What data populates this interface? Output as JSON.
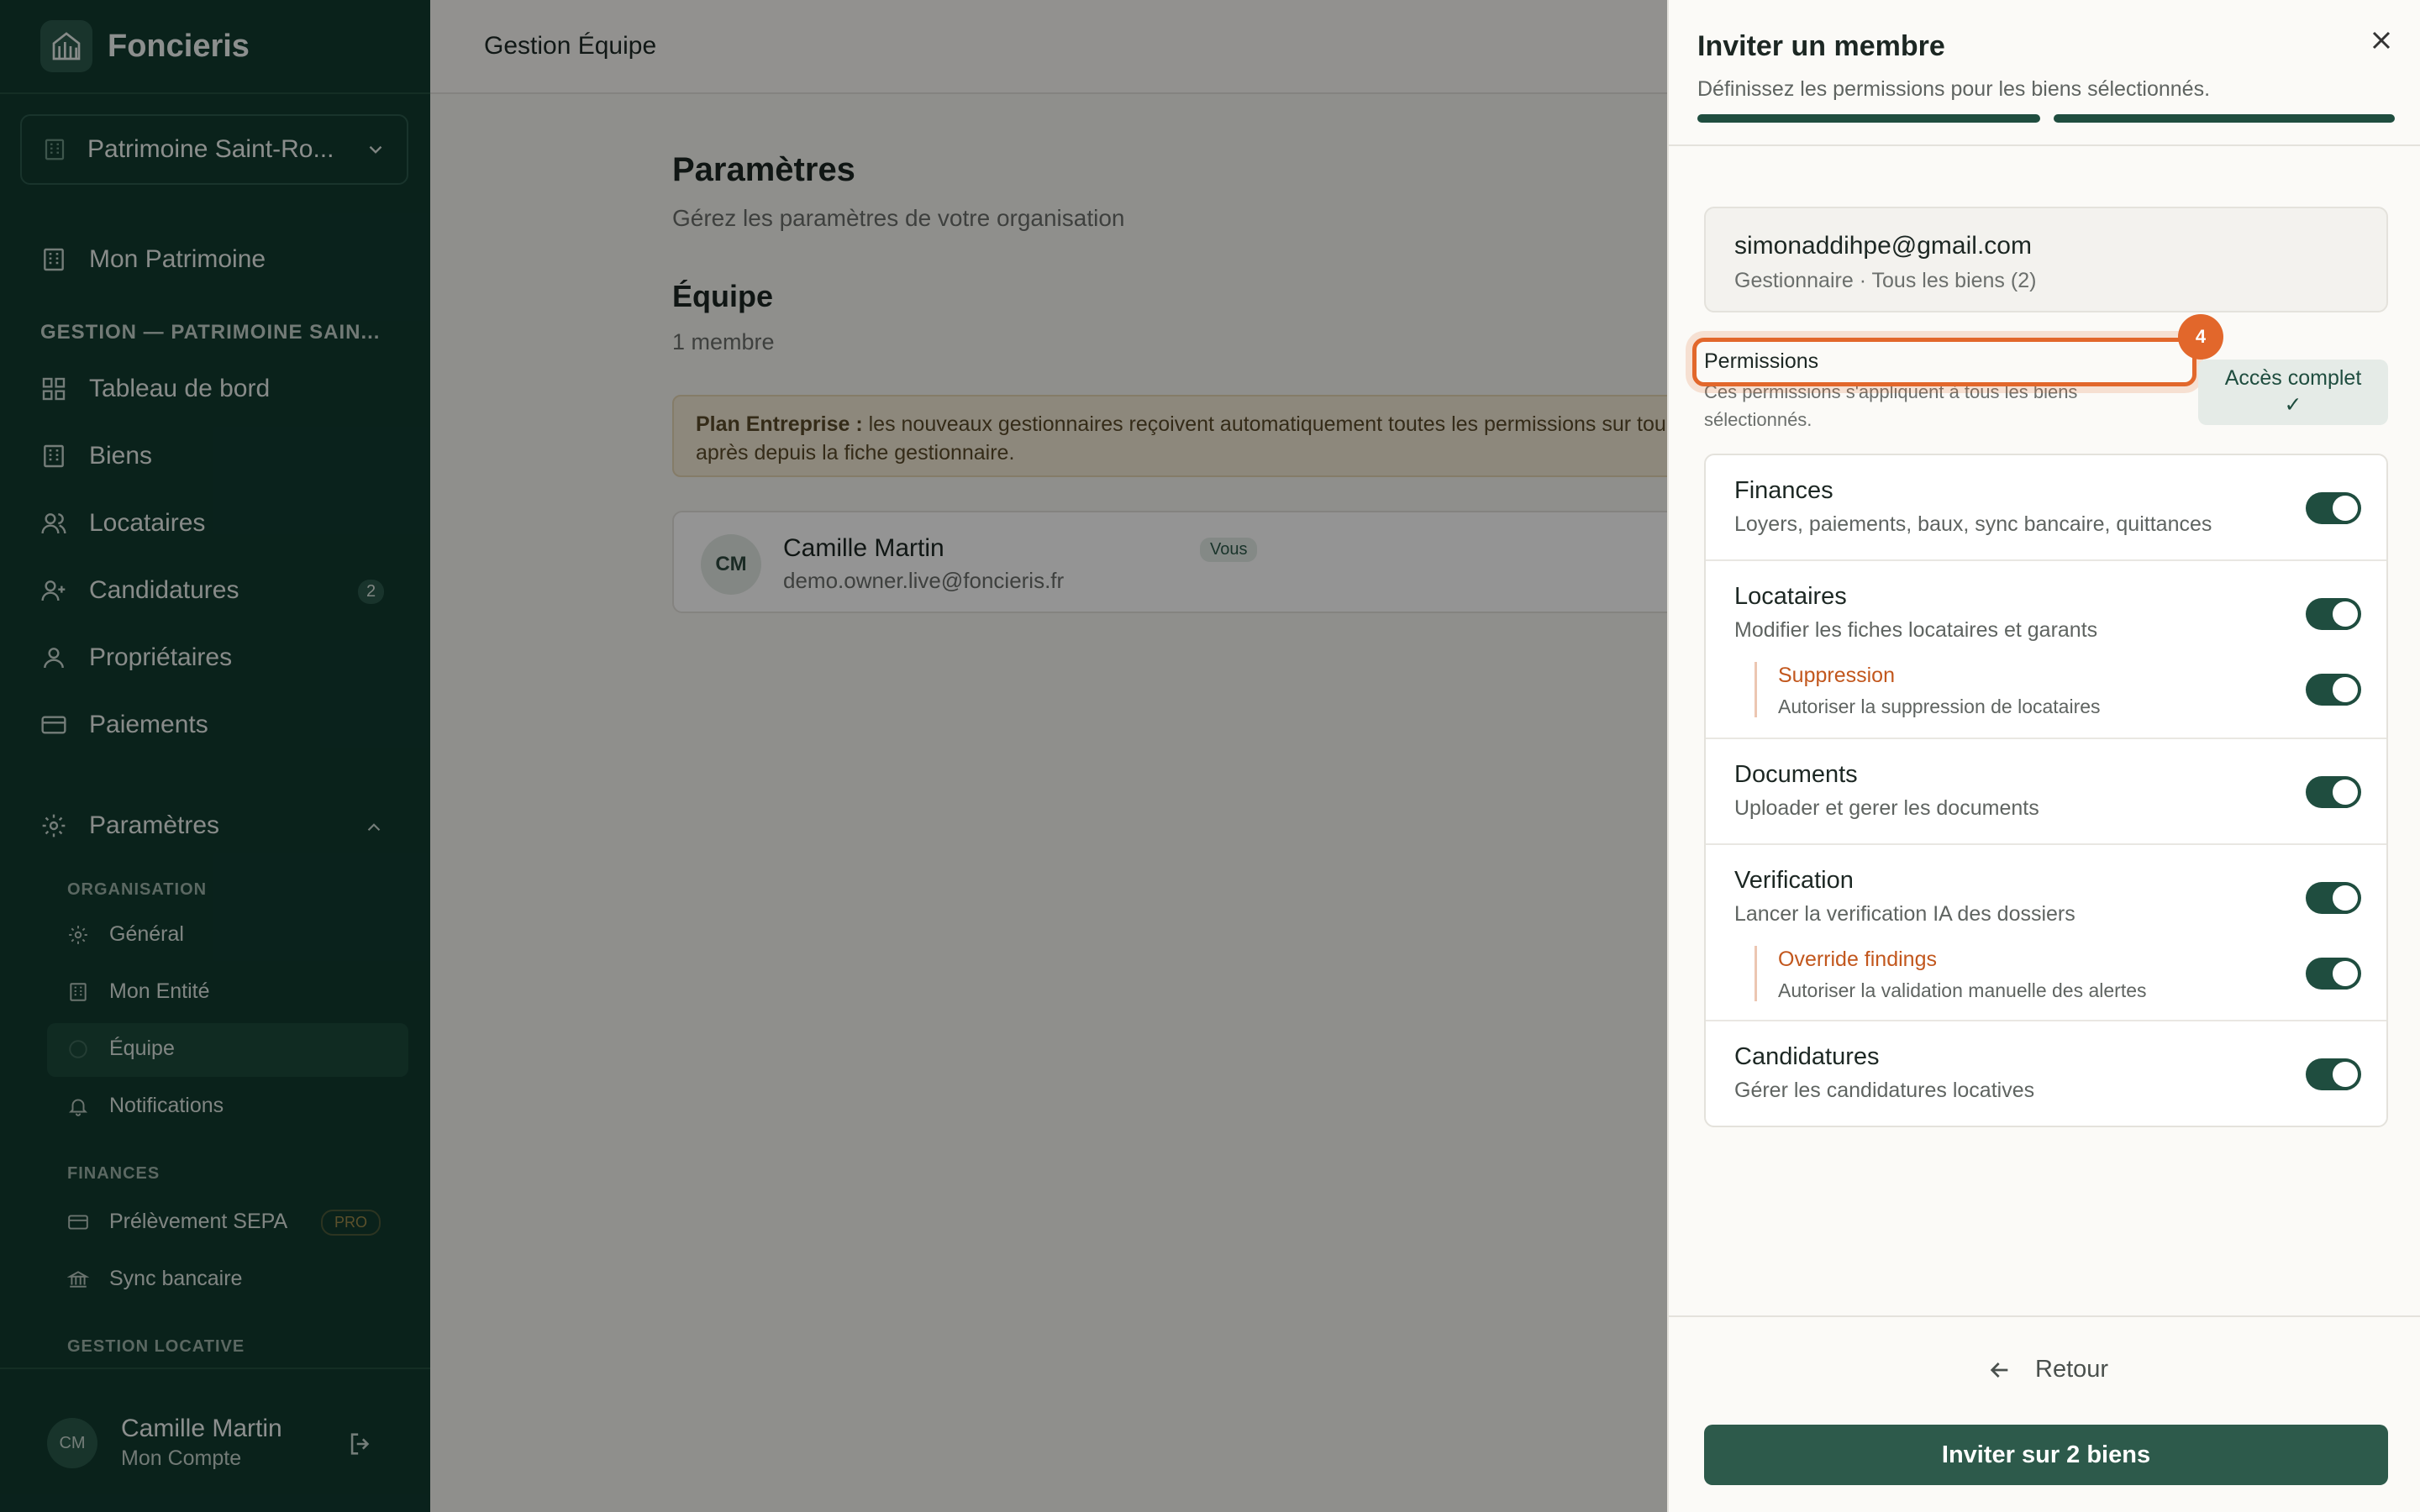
{
  "app": {
    "name": "Foncieris"
  },
  "sidebar": {
    "org_select": "Patrimoine Saint-Ro...",
    "top_items": [
      {
        "label": "Mon Patrimoine",
        "icon": "building-icon"
      }
    ],
    "section_gestion": "GESTION — PATRIMOINE SAIN...",
    "items": [
      {
        "label": "Tableau de bord",
        "icon": "dashboard-icon"
      },
      {
        "label": "Biens",
        "icon": "building-icon"
      },
      {
        "label": "Locataires",
        "icon": "users-icon"
      },
      {
        "label": "Candidatures",
        "icon": "user-plus-icon",
        "badge": "2"
      },
      {
        "label": "Propriétaires",
        "icon": "user-icon"
      },
      {
        "label": "Paiements",
        "icon": "card-icon"
      }
    ],
    "settings": {
      "label": "Paramètres",
      "icon": "gear-icon"
    },
    "sub_org_title": "ORGANISATION",
    "sub_org": [
      {
        "label": "Général",
        "icon": "gear-icon"
      },
      {
        "label": "Mon Entité",
        "icon": "building-icon"
      },
      {
        "label": "Équipe",
        "icon": "team-icon"
      },
      {
        "label": "Notifications",
        "icon": "bell-icon"
      }
    ],
    "sub_fin_title": "FINANCES",
    "sub_fin": [
      {
        "label": "Prélèvement SEPA",
        "icon": "card-icon",
        "badge": "PRO"
      },
      {
        "label": "Sync bancaire",
        "icon": "bank-icon"
      }
    ],
    "sub_loc_title": "GESTION LOCATIVE",
    "user": {
      "initials": "CM",
      "name": "Camille Martin",
      "sub": "Mon Compte"
    }
  },
  "main": {
    "topbar_title": "Gestion Équipe",
    "title": "Paramètres",
    "subtitle": "Gérez les paramètres de votre organisation",
    "team_title": "Équipe",
    "team_count": "1 membre",
    "notice_bold": "Plan Entreprise :",
    "notice_text": " les nouveaux gestionnaires reçoivent automatiquement toutes les permissions sur tou",
    "notice_line2": "après depuis la fiche gestionnaire.",
    "member": {
      "initials": "CM",
      "name": "Camille Martin",
      "tag": "Vous",
      "email": "demo.owner.live@foncieris.fr"
    }
  },
  "drawer": {
    "title": "Inviter un membre",
    "subtitle": "Définissez les permissions pour les biens sélectionnés.",
    "email": "simonaddihpe@gmail.com",
    "email_sub": "Gestionnaire · Tous les biens (2)",
    "permissions_label": "Permissions",
    "step": "4",
    "permissions_note": "Ces permissions s'appliquent à tous les biens sélectionnés.",
    "full_access": "Accès complet",
    "full_access_check": "✓",
    "perms": [
      {
        "title": "Finances",
        "desc": "Loyers, paiements, baux, sync bancaire, quittances",
        "on": true
      },
      {
        "title": "Locataires",
        "desc": "Modifier les fiches locataires et garants",
        "on": true,
        "sub": {
          "title": "Suppression",
          "desc": "Autoriser la suppression de locataires",
          "on": true
        }
      },
      {
        "title": "Documents",
        "desc": "Uploader et gerer les documents",
        "on": true
      },
      {
        "title": "Verification",
        "desc": "Lancer la verification IA des dossiers",
        "on": true,
        "sub": {
          "title": "Override findings",
          "desc": "Autoriser la validation manuelle des alertes",
          "on": true
        }
      },
      {
        "title": "Candidatures",
        "desc": "Gérer les candidatures locatives",
        "on": true
      }
    ],
    "back": "Retour",
    "submit": "Inviter sur 2 biens"
  },
  "colors": {
    "sidebar": "#123b30",
    "accent": "#1f4d3f",
    "highlight": "#e2672b",
    "warning": "#c2571d"
  }
}
